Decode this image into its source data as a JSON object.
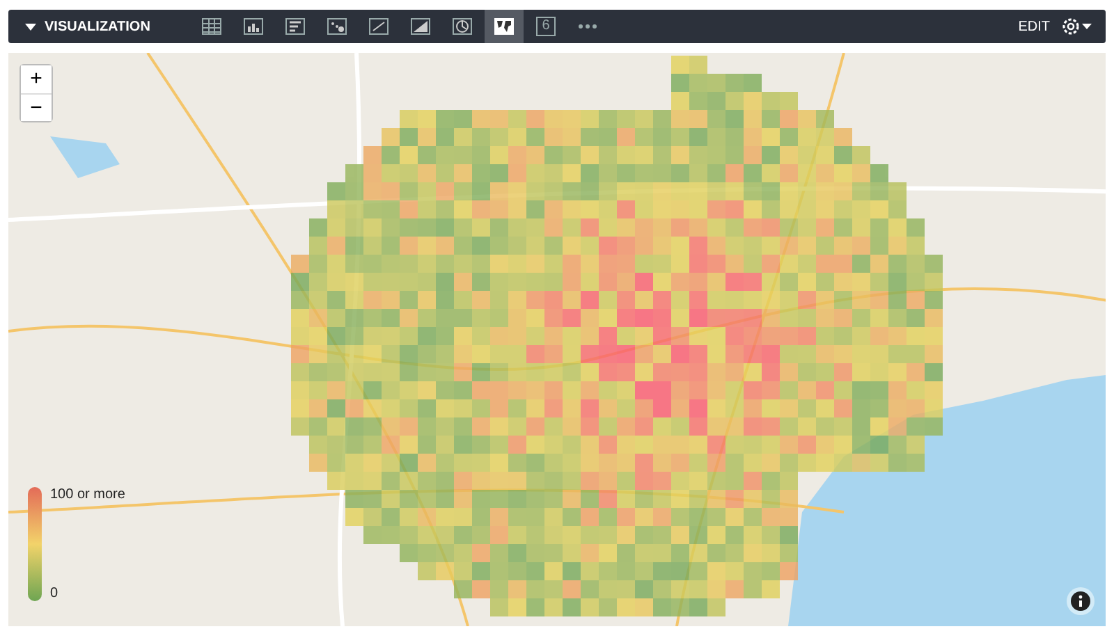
{
  "toolbar": {
    "title": "VISUALIZATION",
    "chart_types": [
      {
        "kind": "table",
        "selected": false
      },
      {
        "kind": "column",
        "selected": false
      },
      {
        "kind": "bar",
        "selected": false
      },
      {
        "kind": "scatter",
        "selected": false
      },
      {
        "kind": "line",
        "selected": false
      },
      {
        "kind": "area",
        "selected": false
      },
      {
        "kind": "pie",
        "selected": false
      },
      {
        "kind": "map",
        "selected": true
      },
      {
        "kind": "single_value",
        "label": "6",
        "selected": false
      },
      {
        "kind": "more",
        "selected": false
      }
    ],
    "edit_label": "EDIT"
  },
  "map": {
    "zoom_in": "+",
    "zoom_out": "−",
    "legend": {
      "max_label": "100 or more",
      "min_label": "0"
    }
  }
}
